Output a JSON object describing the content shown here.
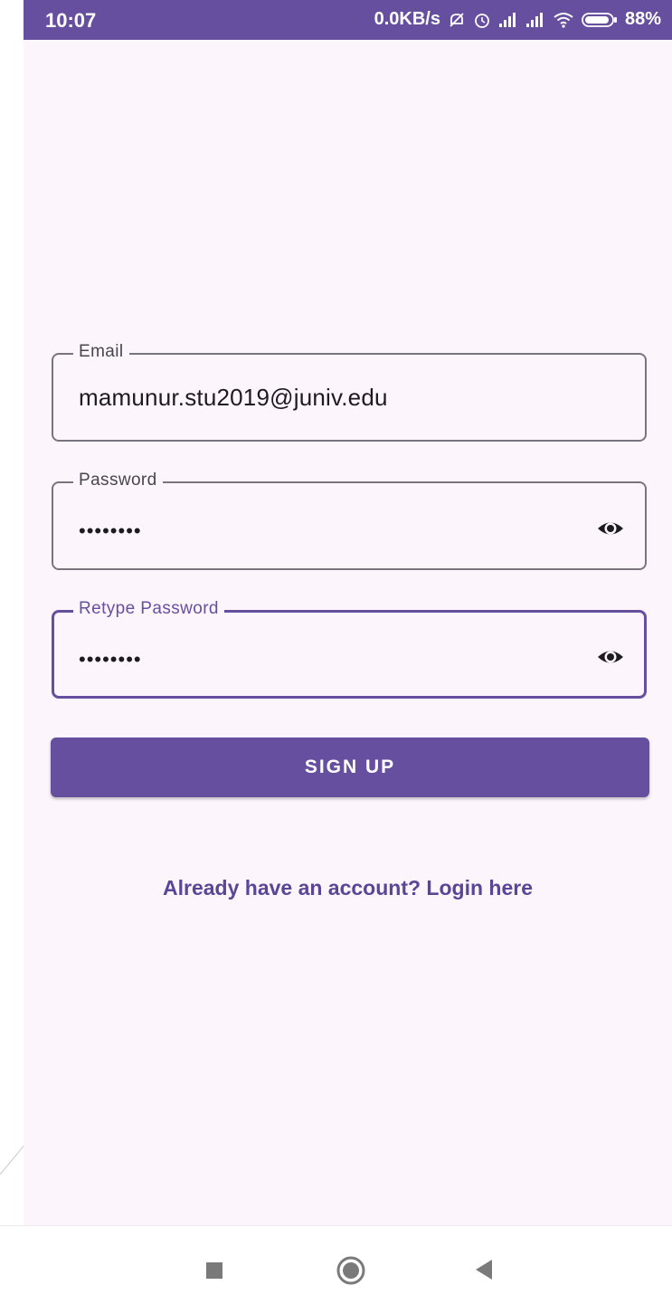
{
  "status_bar": {
    "time": "10:07",
    "network_speed": "0.0KB/s",
    "battery": "88%",
    "icons": [
      "mute-icon",
      "alarm-icon",
      "signal-icon",
      "signal-icon",
      "wifi-icon",
      "battery-icon"
    ]
  },
  "form": {
    "email": {
      "label": "Email",
      "value": "mamunur.stu2019@juniv.edu"
    },
    "password": {
      "label": "Password",
      "value": "••••••••",
      "toggle_icon": "eye-icon"
    },
    "retype_password": {
      "label": "Retype Password",
      "value": "••••••••",
      "toggle_icon": "eye-icon",
      "focused": true
    },
    "signup_label": "SIGN UP",
    "login_link": "Already have an account? Login here"
  },
  "nav_bar": {
    "icons": [
      "recents-square-icon",
      "home-circle-icon",
      "back-triangle-icon"
    ]
  },
  "colors": {
    "accent": "#674fa0",
    "background": "#fcf6fc",
    "outline": "#7a7480",
    "text": "#1d1b20"
  }
}
